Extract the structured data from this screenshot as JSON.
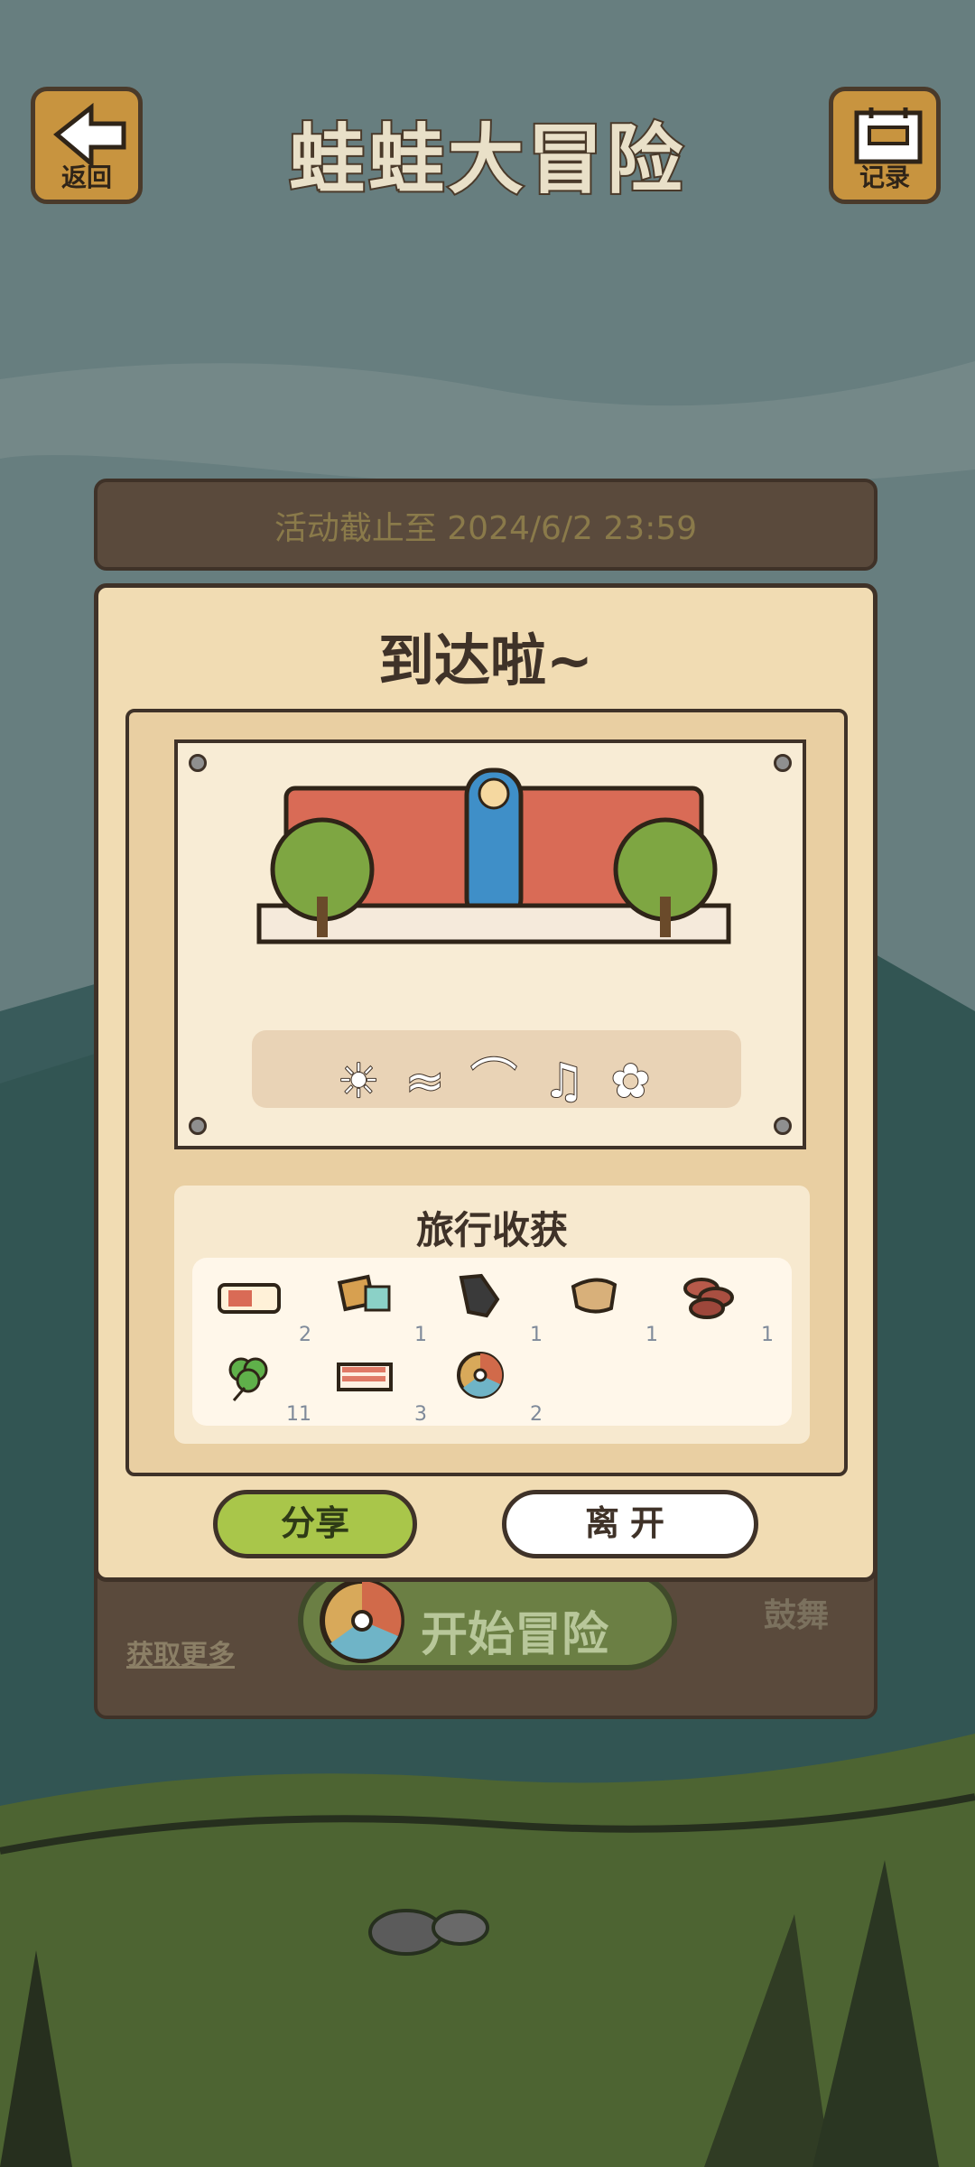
{
  "header": {
    "back_label": "返回",
    "title": "蛙蛙大冒险",
    "record_label": "记录"
  },
  "event": {
    "deadline_text": "活动截止至 2024/6/2 23:59"
  },
  "dialog": {
    "title": "到达啦~",
    "message_glyphs": "☀ ≈ ⌒ ♫ ✿",
    "rewards_title": "旅行收获",
    "rewards": [
      {
        "icon": "ticket-icon",
        "qty": "2"
      },
      {
        "icon": "craft-materials-icon",
        "qty": "1"
      },
      {
        "icon": "charcoal-icon",
        "qty": "1"
      },
      {
        "icon": "bread-loaf-icon",
        "qty": "1"
      },
      {
        "icon": "sausage-slices-icon",
        "qty": "1"
      },
      {
        "icon": "four-leaf-clover-icon",
        "qty": "11"
      },
      {
        "icon": "red-ticket-icon",
        "qty": "3"
      },
      {
        "icon": "compass-wheel-icon",
        "qty": "2"
      }
    ],
    "share_label": "分享",
    "leave_label": "离开"
  },
  "lower": {
    "get_more_label": "获取更多",
    "start_label": "开始冒险",
    "encourage_label": "鼓舞"
  },
  "colors": {
    "wood_dark": "#5a4a3c",
    "paper": "#f1dcb3",
    "share_green": "#a9c64a",
    "grass": "#5f7b3d"
  }
}
